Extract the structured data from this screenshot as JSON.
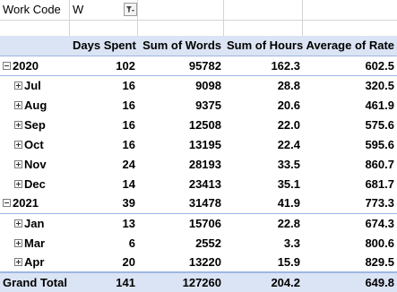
{
  "filter": {
    "field_label": "Work Code",
    "field_value": "W",
    "icon": "filter-dropdown-icon"
  },
  "headers": [
    "",
    "Days Spent",
    "Sum of Words",
    "Sum of Hours",
    "Average of Rate"
  ],
  "rows": [
    {
      "label": "2020",
      "level": 0,
      "toggle": "minus",
      "values": [
        "102",
        "95782",
        "162.3",
        "602.5"
      ]
    },
    {
      "label": "Jul",
      "level": 1,
      "toggle": "plus",
      "values": [
        "16",
        "9098",
        "28.8",
        "320.5"
      ]
    },
    {
      "label": "Aug",
      "level": 1,
      "toggle": "plus",
      "values": [
        "16",
        "9375",
        "20.6",
        "461.9"
      ]
    },
    {
      "label": "Sep",
      "level": 1,
      "toggle": "plus",
      "values": [
        "16",
        "12508",
        "22.0",
        "575.6"
      ]
    },
    {
      "label": "Oct",
      "level": 1,
      "toggle": "plus",
      "values": [
        "16",
        "13195",
        "22.4",
        "595.6"
      ]
    },
    {
      "label": "Nov",
      "level": 1,
      "toggle": "plus",
      "values": [
        "24",
        "28193",
        "33.5",
        "860.7"
      ]
    },
    {
      "label": "Dec",
      "level": 1,
      "toggle": "plus",
      "values": [
        "14",
        "23413",
        "35.1",
        "681.7"
      ]
    },
    {
      "label": "2021",
      "level": 0,
      "toggle": "minus",
      "values": [
        "39",
        "31478",
        "41.9",
        "773.3"
      ]
    },
    {
      "label": "Jan",
      "level": 1,
      "toggle": "plus",
      "values": [
        "13",
        "15706",
        "22.8",
        "674.3"
      ]
    },
    {
      "label": "Mar",
      "level": 1,
      "toggle": "plus",
      "values": [
        "6",
        "2552",
        "3.3",
        "800.6"
      ]
    },
    {
      "label": "Apr",
      "level": 1,
      "toggle": "plus",
      "values": [
        "20",
        "13220",
        "15.9",
        "829.5"
      ]
    }
  ],
  "total": {
    "label": "Grand Total",
    "values": [
      "141",
      "127260",
      "204.2",
      "649.8"
    ]
  },
  "colors": {
    "header_fill": "#dbe4f4",
    "header_border": "#9db6e3",
    "gridline": "#d4d4d4"
  }
}
